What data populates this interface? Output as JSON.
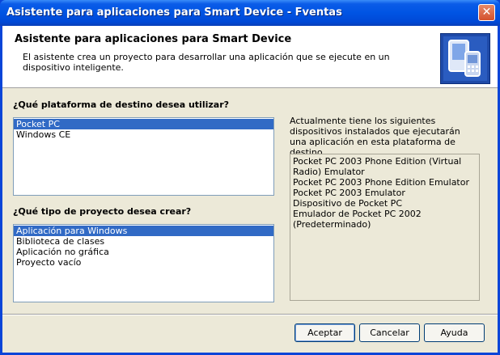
{
  "window": {
    "title": "Asistente para aplicaciones para Smart Device - Fventas",
    "close_glyph": "✕"
  },
  "header": {
    "title": "Asistente para aplicaciones para Smart Device",
    "description": "El asistente crea un proyecto para desarrollar una aplicación que se ejecute en un dispositivo inteligente.",
    "icon": "smart-device-icon"
  },
  "platform": {
    "label": "¿Qué plataforma de destino desea utilizar?",
    "items": [
      "Pocket PC",
      "Windows CE"
    ],
    "selected": "Pocket PC"
  },
  "project_type": {
    "label": "¿Qué tipo de proyecto desea crear?",
    "items": [
      "Aplicación para Windows",
      "Biblioteca de clases",
      "Aplicación no gráfica",
      "Proyecto vacío"
    ],
    "selected": "Aplicación para Windows"
  },
  "devices": {
    "info": "Actualmente tiene los siguientes dispositivos instalados que ejecutarán una aplicación en esta plataforma de destino.",
    "items": [
      "Pocket PC 2003 Phone Edition (Virtual Radio) Emulator",
      "Pocket PC 2003 Phone Edition Emulator",
      "Pocket PC 2003 Emulator",
      "Dispositivo de Pocket PC",
      "Emulador de Pocket PC 2002 (Predeterminado)"
    ]
  },
  "buttons": {
    "ok": "Aceptar",
    "cancel": "Cancelar",
    "help": "Ayuda"
  },
  "colors": {
    "titlebar": "#0054e3",
    "selection": "#316ac5",
    "dialog_bg": "#ece9d8"
  }
}
